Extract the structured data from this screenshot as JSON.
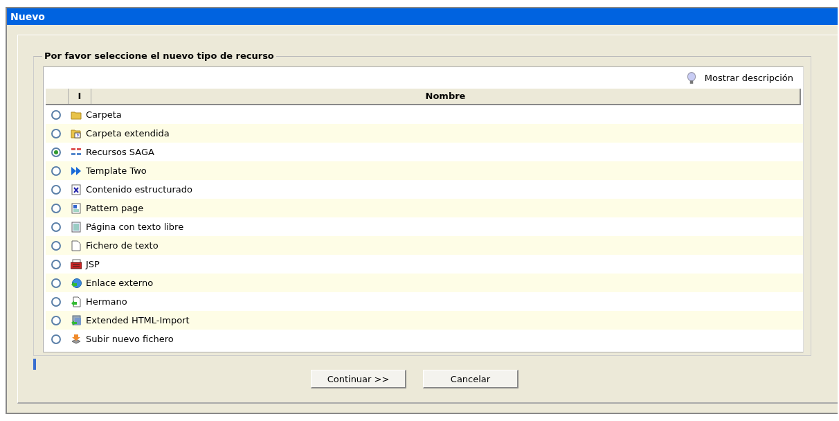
{
  "window": {
    "title": "Nuevo"
  },
  "group": {
    "legend": "Por favor seleccione el nuevo tipo de recurso"
  },
  "description_toggle": {
    "label": "Mostrar descripción"
  },
  "table": {
    "columns": [
      "I",
      "Nombre"
    ],
    "rows": [
      {
        "name": "Carpeta",
        "selected": false
      },
      {
        "name": "Carpeta extendida",
        "selected": false
      },
      {
        "name": "Recursos SAGA",
        "selected": true
      },
      {
        "name": "Template Two",
        "selected": false
      },
      {
        "name": "Contenido estructurado",
        "selected": false
      },
      {
        "name": "Pattern page",
        "selected": false
      },
      {
        "name": "Página con texto libre",
        "selected": false
      },
      {
        "name": "Fichero de texto",
        "selected": false
      },
      {
        "name": "JSP",
        "selected": false
      },
      {
        "name": "Enlace externo",
        "selected": false
      },
      {
        "name": "Hermano",
        "selected": false
      },
      {
        "name": "Extended HTML-Import",
        "selected": false
      },
      {
        "name": "Subir nuevo fichero",
        "selected": false
      }
    ]
  },
  "buttons": [
    "Continuar >>",
    "Cancelar"
  ]
}
